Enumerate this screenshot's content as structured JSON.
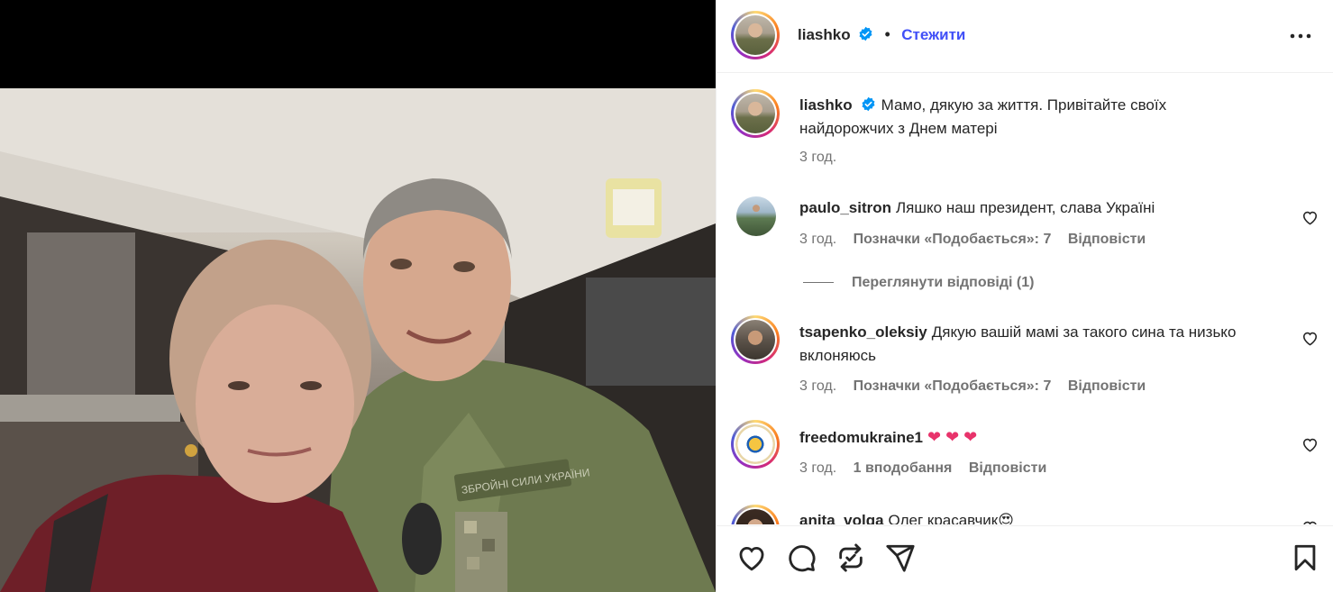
{
  "post": {
    "author": "liashko",
    "follow_label": "Стежити",
    "separator": "•",
    "caption": "Мамо, дякую за життя. Привітайте своїх найдорожчих з Днем матері",
    "caption_time": "3 год."
  },
  "photo": {
    "patch_text": "ЗБРОЙНІ СИЛИ УКРАЇНИ"
  },
  "comments": [
    {
      "user": "paulo_sitron",
      "text": "Ляшко наш президент, слава Україні",
      "time": "3 год.",
      "likes": "Позначки «Подобається»: 7",
      "reply": "Відповісти",
      "view_replies": "Переглянути відповіді (1)"
    },
    {
      "user": "tsapenko_oleksiy",
      "text": "Дякую вашій мамі за такого сина та низько вклоняюсь",
      "time": "3 год.",
      "likes": "Позначки «Подобається»: 7",
      "reply": "Відповісти"
    },
    {
      "user": "freedomukraine1",
      "text": "❤ ❤ ❤",
      "time": "3 год.",
      "likes": "1 вподобання",
      "reply": "Відповісти"
    },
    {
      "user": "anita_volga",
      "text": "Олег красавчик😍"
    }
  ],
  "icons": {
    "verified": "verified-badge-icon",
    "more": "more-options-icon",
    "like": "heart-icon",
    "comment": "comment-icon",
    "repost": "repost-icon",
    "share": "send-icon",
    "save": "bookmark-icon"
  },
  "colors": {
    "follow": "#4150f7",
    "verified": "#0095f6",
    "secondary_text": "#737373",
    "heart_emoji": "#e8336b"
  }
}
